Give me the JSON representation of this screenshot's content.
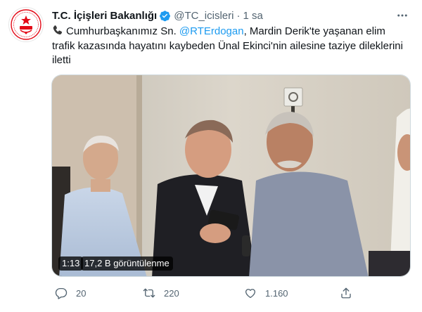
{
  "tweet": {
    "avatar_icon": "ministry-emblem-icon",
    "author_name": "T.C. İçişleri Bakanlığı",
    "verified_icon": "verified-badge-icon",
    "handle": "@TC_icisleri",
    "separator": "·",
    "time": "1 sa",
    "more_icon": "more-options-icon",
    "text_icon": "telephone-receiver-icon",
    "text_before": "Cumhurbaşkanımız Sn. ",
    "mention": "@RTErdogan",
    "text_after": ", Mardin Derik'te yaşanan elim trafik kazasında hayatını kaybeden Ünal Ekinci'nin ailesine taziye dileklerini iletti",
    "video": {
      "duration": "1:13",
      "views": "17,2 B görüntülenme"
    },
    "actions": {
      "reply_icon": "reply-icon",
      "reply_count": "20",
      "retweet_icon": "retweet-icon",
      "retweet_count": "220",
      "like_icon": "heart-icon",
      "like_count": "1.160",
      "share_icon": "share-icon"
    }
  },
  "colors": {
    "accent": "#1d9bf0",
    "secondary_text": "#536471",
    "emblem_red": "#e30a17"
  }
}
